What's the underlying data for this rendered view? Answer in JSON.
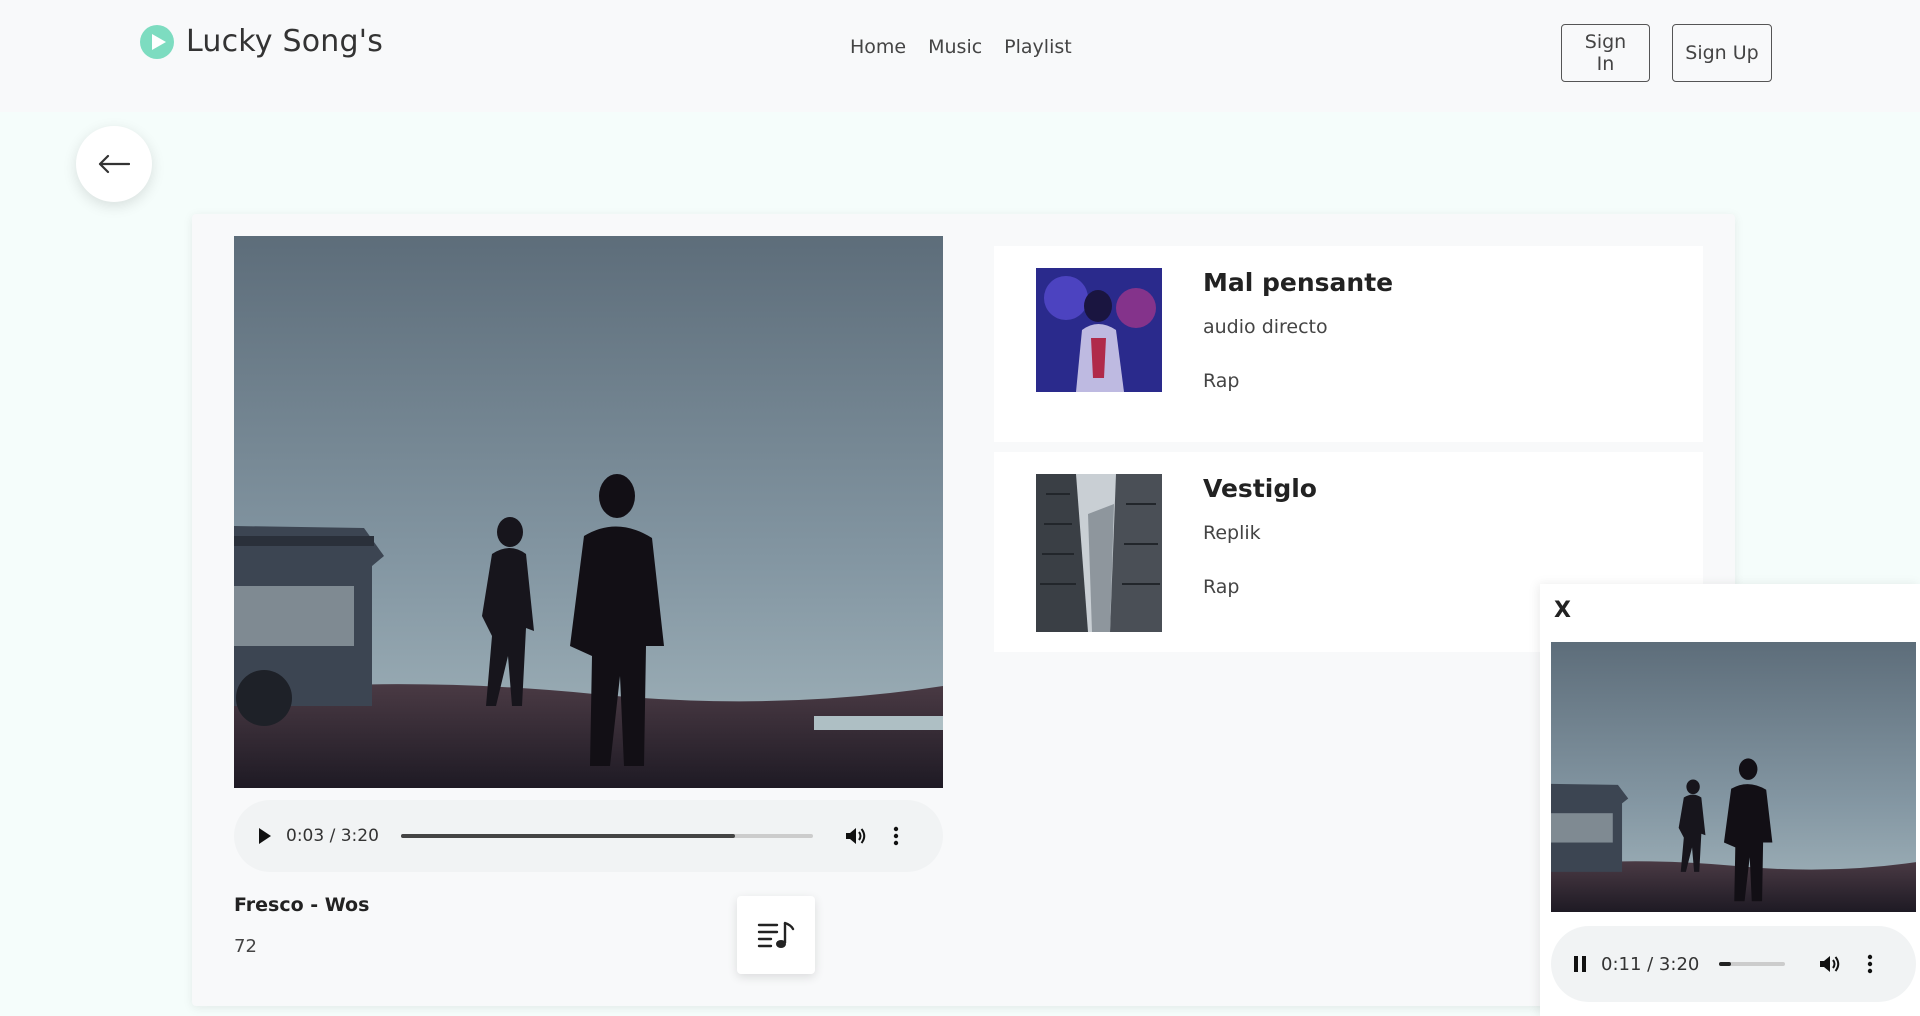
{
  "header": {
    "brand": "Lucky Song's",
    "nav": [
      "Home",
      "Music",
      "Playlist"
    ],
    "sign_in": "Sign In",
    "sign_up": "Sign Up"
  },
  "main_player": {
    "time": "0:03 / 3:20",
    "progress": 0.81,
    "title": "Fresco - Wos",
    "count": "72"
  },
  "songs": [
    {
      "title": "Mal pensante",
      "artist": "audio directo",
      "genre": "Rap"
    },
    {
      "title": "Vestiglo",
      "artist": "Replik",
      "genre": "Rap"
    }
  ],
  "mini_player": {
    "close": "X",
    "time": "0:11 / 3:20",
    "progress": 0.17
  },
  "colors": {
    "accent": "#7ddcc0",
    "page_bg": "#f5fdfb",
    "header_bg": "#f8f9fa"
  },
  "icons": [
    "play-circle-icon",
    "arrow-left-icon",
    "play-icon",
    "pause-icon",
    "volume-icon",
    "more-vertical-icon",
    "playlist-music-icon",
    "close-icon"
  ]
}
